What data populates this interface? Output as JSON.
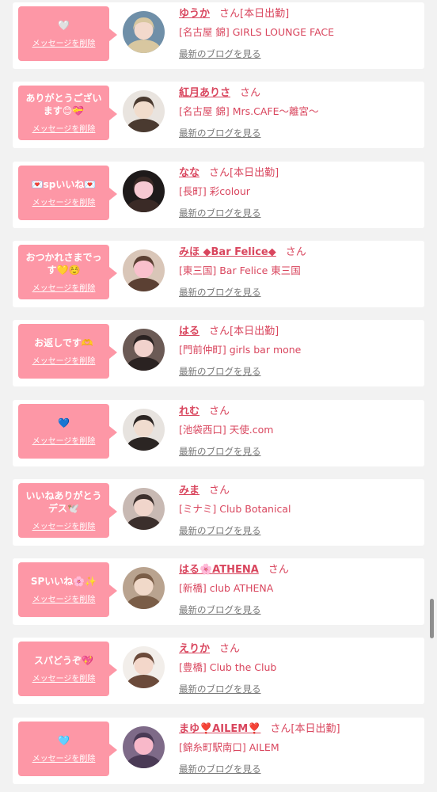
{
  "messages": [
    {
      "message": "🤍",
      "delete_label": "メッセージを削除",
      "name": "ゆうか",
      "suffix": "さん",
      "status": "[本日出勤]",
      "shop": "[名古屋 錦] GIRLS LOUNGE FACE",
      "blog_label": "最新のブログを見る"
    },
    {
      "message": "ありがとうございます😊💝",
      "delete_label": "メッセージを削除",
      "name": "紅月ありさ",
      "suffix": "さん",
      "status": "",
      "shop": "[名古屋 錦] Mrs.CAFE〜離宮〜",
      "blog_label": "最新のブログを見る"
    },
    {
      "message": "💌spいいね💌",
      "delete_label": "メッセージを削除",
      "name": "なな",
      "suffix": "さん",
      "status": "[本日出勤]",
      "shop": "[長町] 彩colour",
      "blog_label": "最新のブログを見る"
    },
    {
      "message": "おつかれさまでっす💛☺️",
      "delete_label": "メッセージを削除",
      "name": "みほ ◆Bar Felice◆",
      "suffix": "さん",
      "status": "",
      "shop": "[東三国] Bar Felice 東三国",
      "blog_label": "最新のブログを見る"
    },
    {
      "message": "お返しです🫶",
      "delete_label": "メッセージを削除",
      "name": "はる",
      "suffix": "さん",
      "status": "[本日出勤]",
      "shop": "[門前仲町] girls bar mone",
      "blog_label": "最新のブログを見る"
    },
    {
      "message": "💙",
      "delete_label": "メッセージを削除",
      "name": "れむ",
      "suffix": "さん",
      "status": "",
      "shop": "[池袋西口] 天使.com",
      "blog_label": "最新のブログを見る"
    },
    {
      "message": "いいねありがとうデス🕊️",
      "delete_label": "メッセージを削除",
      "name": "みま",
      "suffix": "さん",
      "status": "",
      "shop": "[ミナミ] Club Botanical",
      "blog_label": "最新のブログを見る"
    },
    {
      "message": "SPいいね🌸✨",
      "delete_label": "メッセージを削除",
      "name": "はる🌸ATHENA",
      "suffix": "さん",
      "status": "",
      "shop": "[新橋] club ATHENA",
      "blog_label": "最新のブログを見る"
    },
    {
      "message": "スパどうぞ💖",
      "delete_label": "メッセージを削除",
      "name": "えりか",
      "suffix": "さん",
      "status": "",
      "shop": "[豊橋] Club the Club",
      "blog_label": "最新のブログを見る"
    },
    {
      "message": "🩵",
      "delete_label": "メッセージを削除",
      "name": "まゆ❣️AILEM❣️",
      "suffix": "さん",
      "status": "[本日出勤]",
      "shop": "[錦糸町駅南口] AILEM",
      "blog_label": "最新のブログを見る"
    }
  ],
  "colors": {
    "bubble": "#fd97a6",
    "accent_text": "#d9465e",
    "blog_link": "#777777",
    "page_bg": "#f2f2f2",
    "card_bg": "#ffffff"
  }
}
